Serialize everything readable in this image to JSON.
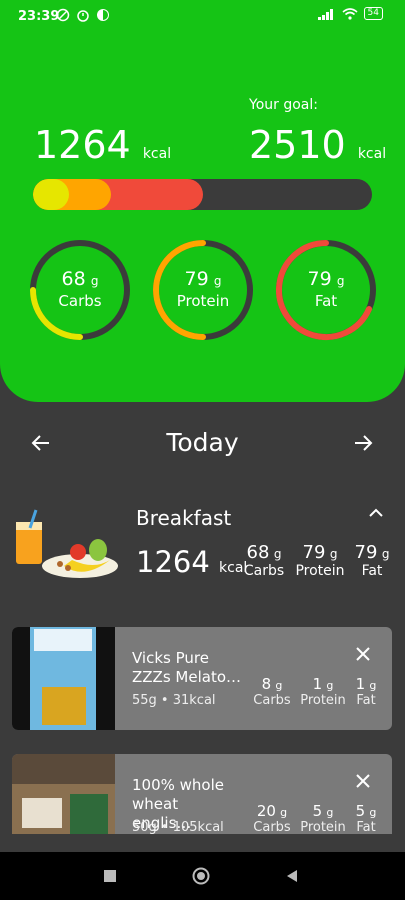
{
  "status": {
    "time": "23:39",
    "battery": "54"
  },
  "summary": {
    "consumed": "1264",
    "consumed_unit": "kcal",
    "goal_label": "Your goal:",
    "goal": "2510",
    "goal_unit": "kcal",
    "progress_fraction": 0.5
  },
  "macros": [
    {
      "value": "68",
      "unit": "g",
      "label": "Carbs",
      "color": "#e6e600"
    },
    {
      "value": "79",
      "unit": "g",
      "label": "Protein",
      "color": "#ffa500"
    },
    {
      "value": "79",
      "unit": "g",
      "label": "Fat",
      "color": "#f04a3a"
    }
  ],
  "day": {
    "label": "Today"
  },
  "meal": {
    "title": "Breakfast",
    "kcal": "1264",
    "kcal_unit": "kcal",
    "macros": [
      {
        "value": "68",
        "unit": "g",
        "label": "Carbs"
      },
      {
        "value": "79",
        "unit": "g",
        "label": "Protein"
      },
      {
        "value": "79",
        "unit": "g",
        "label": "Fat"
      }
    ]
  },
  "entries": [
    {
      "name": "Vicks Pure ZZZs Melato…",
      "sub": "55g • 31kcal",
      "macros": [
        {
          "value": "8",
          "unit": "g",
          "label": "Carbs"
        },
        {
          "value": "1",
          "unit": "g",
          "label": "Protein"
        },
        {
          "value": "1",
          "unit": "g",
          "label": "Fat"
        }
      ]
    },
    {
      "name": "100% whole wheat englis…",
      "sub": "50g • 105kcal",
      "macros": [
        {
          "value": "20",
          "unit": "g",
          "label": "Carbs"
        },
        {
          "value": "5",
          "unit": "g",
          "label": "Protein"
        },
        {
          "value": "5",
          "unit": "g",
          "label": "Fat"
        }
      ]
    }
  ]
}
